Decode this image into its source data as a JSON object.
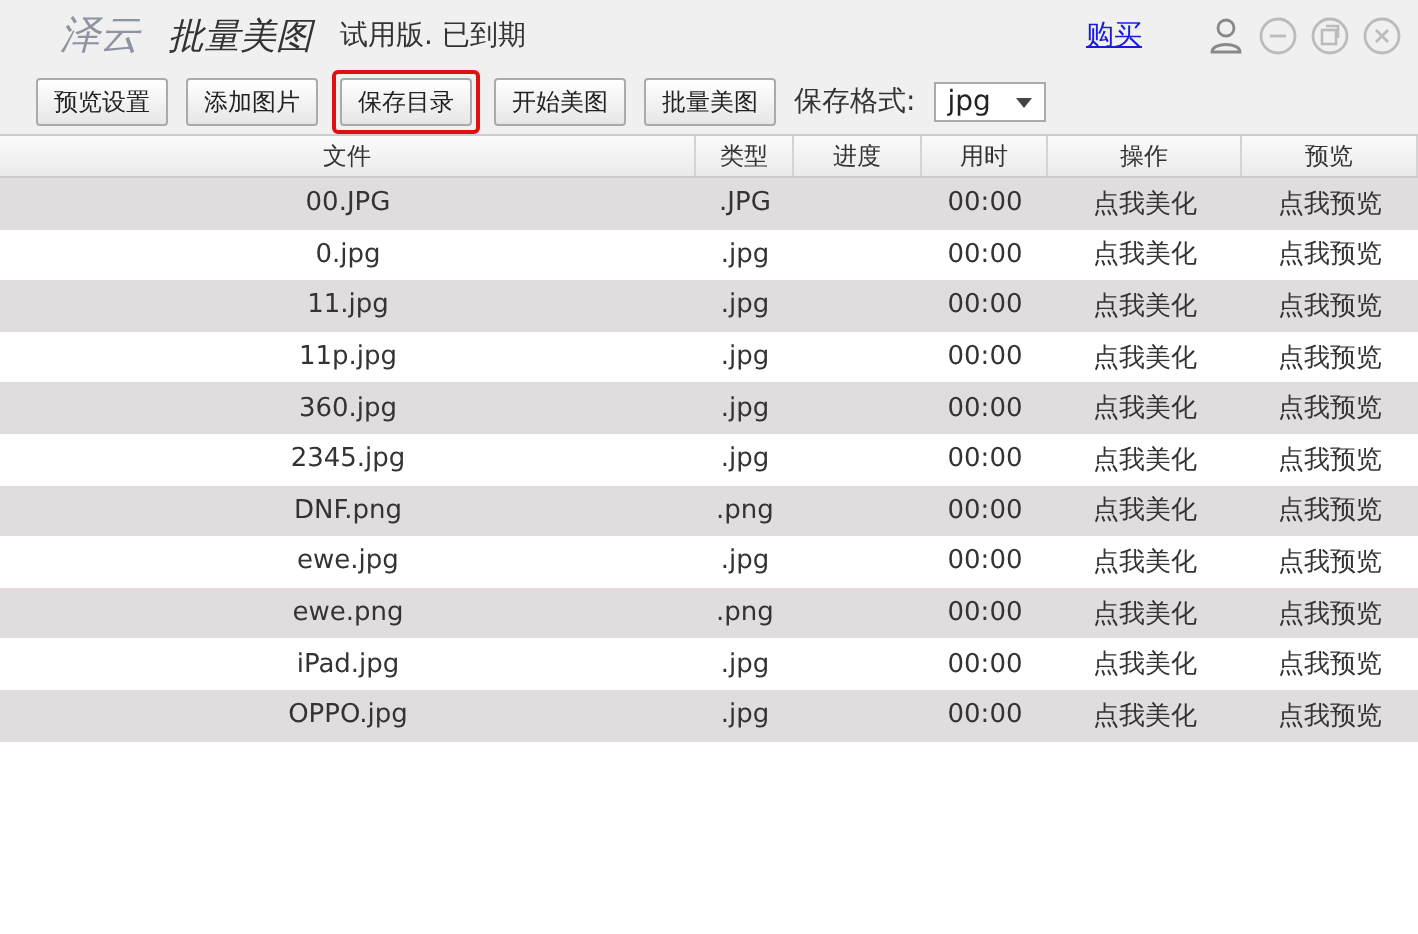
{
  "window": {
    "logo": "泽云",
    "title": "批量美图",
    "status": "试用版. 已到期",
    "buy_link": "购买"
  },
  "toolbar": {
    "buttons": [
      {
        "label": "预览设置",
        "highlighted": false
      },
      {
        "label": "添加图片",
        "highlighted": false
      },
      {
        "label": "保存目录",
        "highlighted": true
      },
      {
        "label": "开始美图",
        "highlighted": false
      },
      {
        "label": "批量美图",
        "highlighted": false
      }
    ],
    "format_label": "保存格式:",
    "format_value": "jpg"
  },
  "table": {
    "columns": [
      "文件",
      "类型",
      "进度",
      "用时",
      "操作",
      "预览"
    ],
    "rows": [
      [
        "00.JPG",
        ".JPG",
        "",
        "00:00",
        "点我美化",
        "点我预览"
      ],
      [
        "0.jpg",
        ".jpg",
        "",
        "00:00",
        "点我美化",
        "点我预览"
      ],
      [
        "11.jpg",
        ".jpg",
        "",
        "00:00",
        "点我美化",
        "点我预览"
      ],
      [
        "11p.jpg",
        ".jpg",
        "",
        "00:00",
        "点我美化",
        "点我预览"
      ],
      [
        "360.jpg",
        ".jpg",
        "",
        "00:00",
        "点我美化",
        "点我预览"
      ],
      [
        "2345.jpg",
        ".jpg",
        "",
        "00:00",
        "点我美化",
        "点我预览"
      ],
      [
        "DNF.png",
        ".png",
        "",
        "00:00",
        "点我美化",
        "点我预览"
      ],
      [
        "ewe.jpg",
        ".jpg",
        "",
        "00:00",
        "点我美化",
        "点我预览"
      ],
      [
        "ewe.png",
        ".png",
        "",
        "00:00",
        "点我美化",
        "点我预览"
      ],
      [
        "iPad.jpg",
        ".jpg",
        "",
        "00:00",
        "点我美化",
        "点我预览"
      ],
      [
        "OPPO.jpg",
        ".jpg",
        "",
        "00:00",
        "点我美化",
        "点我预览"
      ]
    ]
  }
}
